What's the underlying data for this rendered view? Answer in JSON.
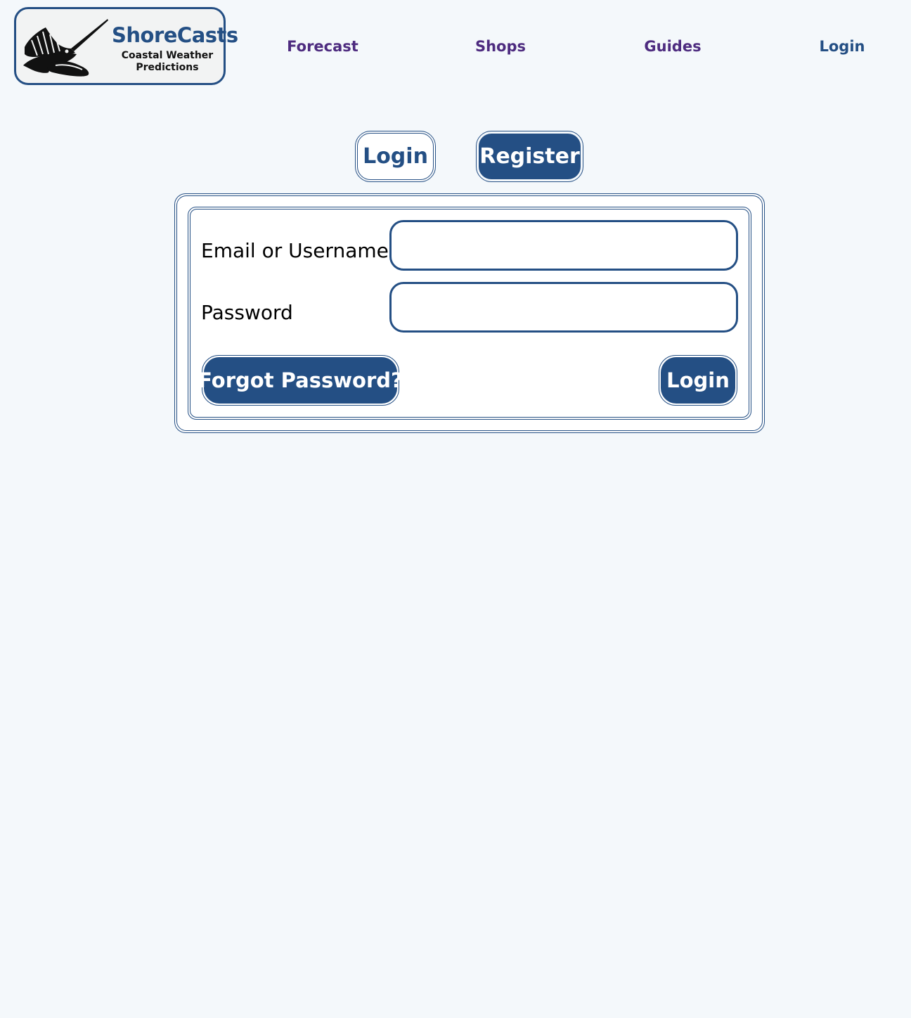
{
  "logo": {
    "brand": "ShoreCasts",
    "tagline_line1": "Coastal Weather",
    "tagline_line2": "Predictions",
    "icon": "sailfish-icon"
  },
  "nav": {
    "items": [
      {
        "label": "Forecast"
      },
      {
        "label": "Shops"
      },
      {
        "label": "Guides"
      },
      {
        "label": "Login"
      }
    ]
  },
  "tabs": {
    "login": "Login",
    "register": "Register"
  },
  "form": {
    "email_label": "Email or Username",
    "email_value": "",
    "password_label": "Password",
    "password_value": "",
    "forgot_button": "Forgot Password?",
    "login_button": "Login"
  },
  "colors": {
    "brand_blue": "#244f84",
    "visited_link": "#4d2b7f",
    "background": "#f4f8fb"
  }
}
